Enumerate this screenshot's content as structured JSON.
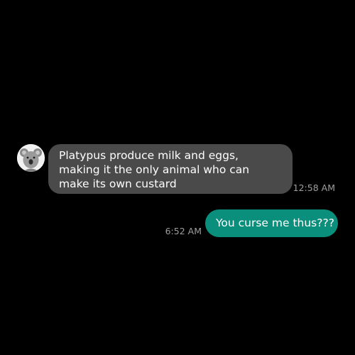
{
  "conversation": {
    "incoming": {
      "avatar_icon": "koala-avatar-icon",
      "text": "Platypus produce milk and eggs, making it the only animal who can make its own custard",
      "timestamp": "12:58 AM",
      "bubble_color": "#4a4a4a"
    },
    "outgoing": {
      "text": "You curse me thus???",
      "timestamp": "6:52 AM",
      "bubble_color": "#0b8f7d"
    }
  }
}
